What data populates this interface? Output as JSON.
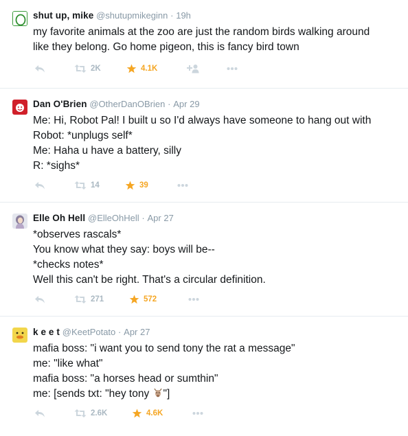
{
  "colors": {
    "name": "#14171a",
    "meta": "#8899a6",
    "action": "#aab8c2",
    "favorite": "#f5a623",
    "divider": "#e6ecf0"
  },
  "tweets": [
    {
      "name": "shut up, mike",
      "handle": "@shutupmikeginn",
      "time": "19h",
      "lines": [
        "my favorite animals at the zoo are just the random birds walking around",
        "like they belong. Go home pigeon, this is fancy bird town"
      ],
      "retweets": "2K",
      "favorites": "4.1K",
      "avatar_icon": "green-egg-avatar-icon"
    },
    {
      "name": "Dan O'Brien",
      "handle": "@OtherDanOBrien",
      "time": "Apr 29",
      "lines": [
        "Me: Hi, Robot Pal! I built u so I'd always have someone to hang out with",
        "Robot: *unplugs self*",
        "Me: Haha u have a battery, silly",
        "R: *sighs*"
      ],
      "retweets": "14",
      "favorites": "39",
      "avatar_icon": "red-face-avatar-icon"
    },
    {
      "name": "Elle Oh Hell",
      "handle": "@ElleOhHell",
      "time": "Apr 27",
      "lines": [
        "*observes rascals*",
        "You know what they say: boys will be--",
        "*checks notes*",
        "Well this can't be right. That's a circular definition."
      ],
      "retweets": "271",
      "favorites": "572",
      "avatar_icon": "portrait-avatar-icon"
    },
    {
      "name": "k e e t",
      "handle": "@KeetPotato",
      "time": "Apr 27",
      "lines": [
        "mafia boss: \"i want you to send tony the rat a message\"",
        "me: \"like what\"",
        "mafia boss: \"a horses head or sumthin\"",
        "me: [sends txt: \"hey tony "
      ],
      "line_suffix": "\"]",
      "emoji_icon": "goat-emoji-icon",
      "retweets": "2.6K",
      "favorites": "4.6K",
      "avatar_icon": "duck-avatar-icon"
    }
  ]
}
